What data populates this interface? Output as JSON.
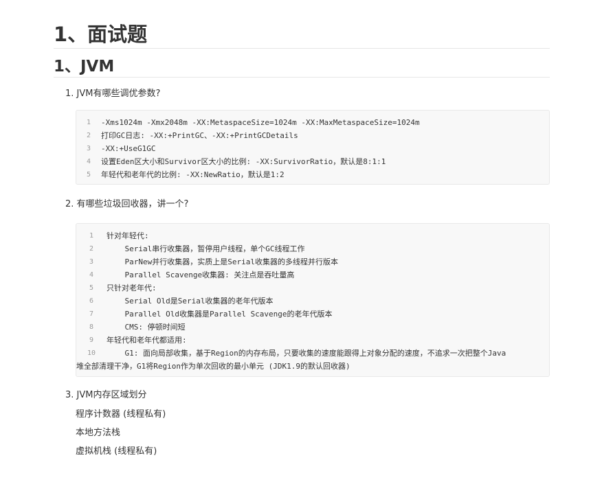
{
  "heading1": "1、面试题",
  "heading2": "1、JVM",
  "questions": [
    "1. JVM有哪些调优参数?",
    "2. 有哪些垃圾回收器，讲一个?",
    "3. JVM内存区域划分"
  ],
  "code_block_1": {
    "lines": [
      {
        "num": "1",
        "text": "-Xms1024m -Xmx2048m -XX:MetaspaceSize=1024m -XX:MaxMetaspaceSize=1024m"
      },
      {
        "num": "2",
        "text": "打印GC日志: -XX:+PrintGC、-XX:+PrintGCDetails"
      },
      {
        "num": "3",
        "text": "-XX:+UseG1GC"
      },
      {
        "num": "4",
        "text": "设置Eden区大小和Survivor区大小的比例: -XX:SurvivorRatio，默认是8:1:1"
      },
      {
        "num": "5",
        "text": "年轻代和老年代的比例: -XX:NewRatio，默认是1:2"
      }
    ]
  },
  "code_block_2": {
    "lines": [
      {
        "num": "1",
        "text": "针对年轻代:"
      },
      {
        "num": "2",
        "text": "    Serial串行收集器，暂停用户线程，单个GC线程工作"
      },
      {
        "num": "3",
        "text": "    ParNew并行收集器，实质上是Serial收集器的多线程并行版本"
      },
      {
        "num": "4",
        "text": "    Parallel Scavenge收集器: 关注点是吞吐量高"
      },
      {
        "num": "5",
        "text": "只针对老年代:"
      },
      {
        "num": "6",
        "text": "    Serial Old是Serial收集器的老年代版本"
      },
      {
        "num": "7",
        "text": "    Parallel Old收集器是Parallel Scavenge的老年代版本"
      },
      {
        "num": "8",
        "text": "    CMS: 停顿时间短"
      },
      {
        "num": "9",
        "text": "年轻代和老年代都适用:"
      },
      {
        "num": "10",
        "text": "    G1: 面向局部收集，基于Region的内存布局，只要收集的速度能跟得上对象分配的速度，不追求一次把整个Java"
      },
      {
        "num": "",
        "text": "堆全部清理干净，G1将Region作为单次回收的最小单元 (JDK1.9的默认回收器)"
      }
    ]
  },
  "memory_areas": [
    "程序计数器 (线程私有)",
    "本地方法栈",
    "虚拟机栈 (线程私有)"
  ]
}
